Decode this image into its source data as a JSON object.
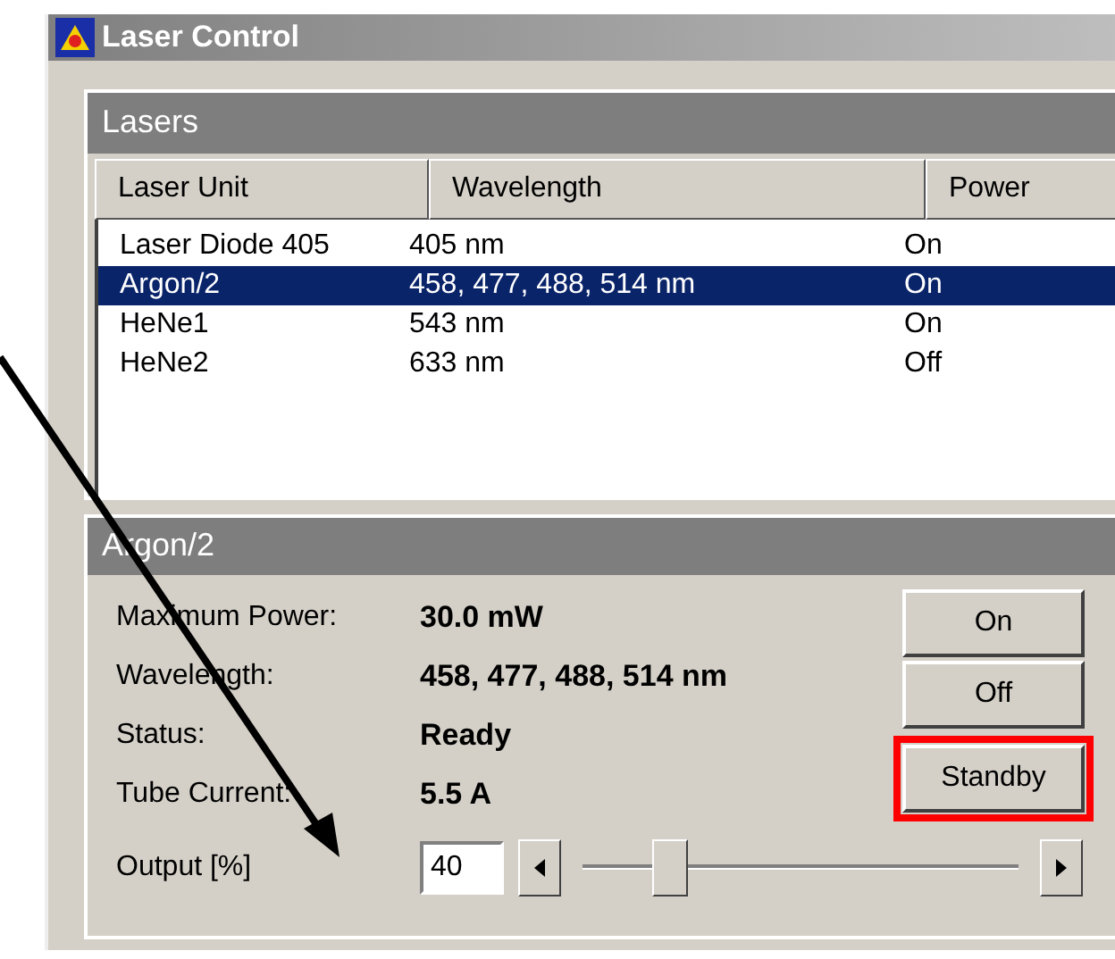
{
  "window": {
    "title": "Laser Control"
  },
  "lasers": {
    "title": "Lasers",
    "columns": [
      "Laser Unit",
      "Wavelength",
      "Power"
    ],
    "rows": [
      {
        "cells": [
          "Laser Diode 405",
          "405 nm",
          "On"
        ],
        "selected": false
      },
      {
        "cells": [
          "Argon/2",
          "458, 477, 488, 514 nm",
          "On"
        ],
        "selected": true
      },
      {
        "cells": [
          "HeNe1",
          "543 nm",
          "On"
        ],
        "selected": false
      },
      {
        "cells": [
          "HeNe2",
          "633 nm",
          "Off"
        ],
        "selected": false
      }
    ]
  },
  "details": {
    "title": "Argon/2",
    "fields": [
      {
        "label": "Maximum Power:",
        "value": "30.0 mW"
      },
      {
        "label": "Wavelength:",
        "value": "458, 477, 488, 514 nm"
      },
      {
        "label": "Status:",
        "value": "Ready"
      },
      {
        "label": "Tube Current:",
        "value": "5.5 A"
      }
    ],
    "buttons": [
      {
        "label": "On",
        "highlighted": false
      },
      {
        "label": "Off",
        "highlighted": false
      },
      {
        "label": "Standby",
        "highlighted": true
      }
    ],
    "output": {
      "label": "Output [%]",
      "value": "40",
      "level": 0.2
    }
  }
}
